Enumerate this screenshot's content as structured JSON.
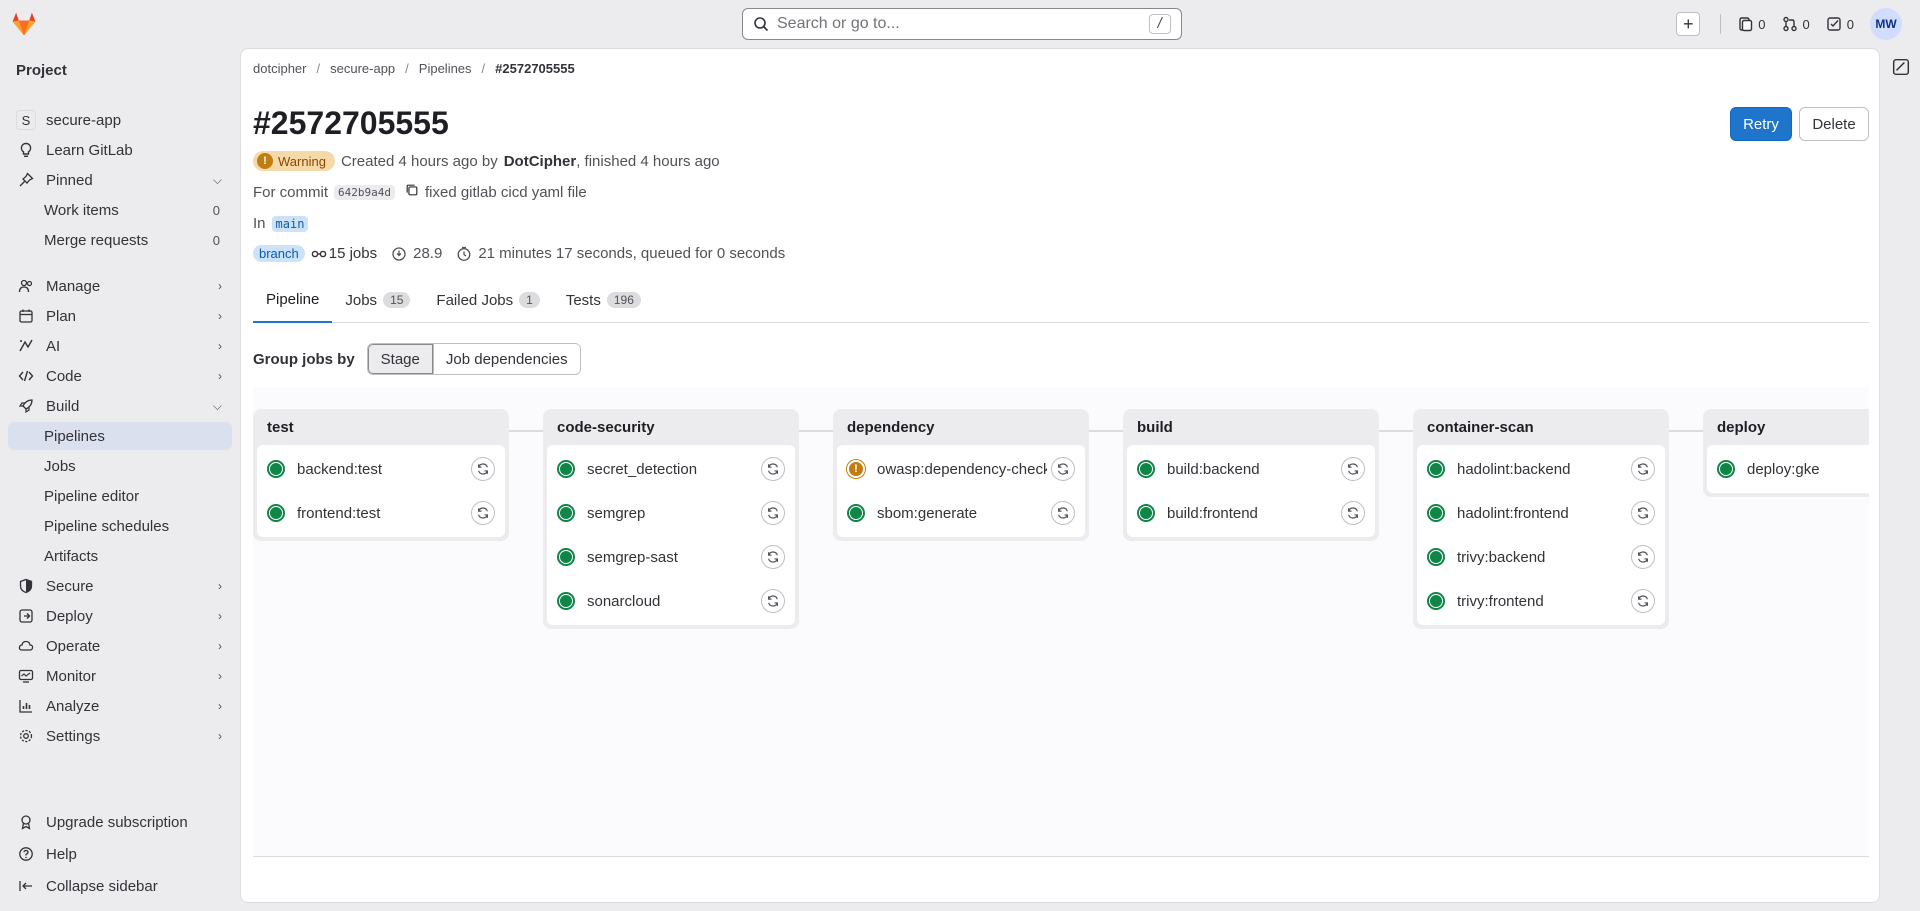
{
  "search": {
    "placeholder": "Search or go to...",
    "shortcut": "/"
  },
  "topbar": {
    "issues_count": "0",
    "merge_requests_count": "0",
    "todos_count": "0",
    "avatar_initials": "MW"
  },
  "sidebar": {
    "heading": "Project",
    "project_initial": "S",
    "items": [
      {
        "label": "secure-app",
        "icon": "project-avatar"
      },
      {
        "label": "Learn GitLab",
        "icon": "bulb-icon"
      },
      {
        "label": "Pinned",
        "icon": "pin-icon"
      },
      {
        "label": "Work items",
        "count": "0"
      },
      {
        "label": "Merge requests",
        "count": "0"
      },
      {
        "label": "Manage",
        "icon": "users-icon"
      },
      {
        "label": "Plan",
        "icon": "planning-icon"
      },
      {
        "label": "AI",
        "icon": "tanuki-ai-icon"
      },
      {
        "label": "Code",
        "icon": "code-icon"
      },
      {
        "label": "Build",
        "icon": "rocket-icon"
      },
      {
        "label": "Pipelines"
      },
      {
        "label": "Jobs"
      },
      {
        "label": "Pipeline editor"
      },
      {
        "label": "Pipeline schedules"
      },
      {
        "label": "Artifacts"
      },
      {
        "label": "Secure",
        "icon": "shield-icon"
      },
      {
        "label": "Deploy",
        "icon": "deployments-icon"
      },
      {
        "label": "Operate",
        "icon": "cloud-gear-icon"
      },
      {
        "label": "Monitor",
        "icon": "monitor-icon"
      },
      {
        "label": "Analyze",
        "icon": "chart-icon"
      },
      {
        "label": "Settings",
        "icon": "settings-icon"
      }
    ],
    "footer": [
      {
        "label": "Upgrade subscription",
        "icon": "license-icon"
      },
      {
        "label": "Help",
        "icon": "question-icon"
      },
      {
        "label": "Collapse sidebar",
        "icon": "collapse-icon"
      }
    ]
  },
  "breadcrumb": [
    "dotcipher",
    "secure-app",
    "Pipelines",
    "#2572705555"
  ],
  "pipeline": {
    "title": "#2572705555",
    "status": "Warning",
    "created_text": "Created 4 hours ago by",
    "author": "DotCipher",
    "finished_text": ", finished 4 hours ago",
    "commit_prefix": "For commit",
    "commit_sha": "642b9a4d",
    "commit_message": "fixed gitlab cicd yaml file",
    "in_prefix": "In",
    "ref": "main",
    "ref_type": "branch",
    "jobs_count": "15 jobs",
    "compute": "28.9",
    "duration": "21 minutes 17 seconds, queued for 0 seconds",
    "retry_label": "Retry",
    "delete_label": "Delete"
  },
  "tabs": [
    {
      "label": "Pipeline",
      "count": null
    },
    {
      "label": "Jobs",
      "count": "15"
    },
    {
      "label": "Failed Jobs",
      "count": "1"
    },
    {
      "label": "Tests",
      "count": "196"
    }
  ],
  "group_by": {
    "label": "Group jobs by",
    "options": [
      "Stage",
      "Job dependencies"
    ],
    "selected": "Stage"
  },
  "stages": [
    {
      "name": "test",
      "jobs": [
        {
          "name": "backend:test",
          "status": "success"
        },
        {
          "name": "frontend:test",
          "status": "success"
        }
      ]
    },
    {
      "name": "code-security",
      "jobs": [
        {
          "name": "secret_detection",
          "status": "success"
        },
        {
          "name": "semgrep",
          "status": "success"
        },
        {
          "name": "semgrep-sast",
          "status": "success"
        },
        {
          "name": "sonarcloud",
          "status": "success"
        }
      ]
    },
    {
      "name": "dependency",
      "jobs": [
        {
          "name": "owasp:dependency-check",
          "status": "warning"
        },
        {
          "name": "sbom:generate",
          "status": "success"
        }
      ]
    },
    {
      "name": "build",
      "jobs": [
        {
          "name": "build:backend",
          "status": "success"
        },
        {
          "name": "build:frontend",
          "status": "success"
        }
      ]
    },
    {
      "name": "container-scan",
      "jobs": [
        {
          "name": "hadolint:backend",
          "status": "success"
        },
        {
          "name": "hadolint:frontend",
          "status": "success"
        },
        {
          "name": "trivy:backend",
          "status": "success"
        },
        {
          "name": "trivy:frontend",
          "status": "success"
        }
      ]
    },
    {
      "name": "deploy",
      "jobs": [
        {
          "name": "deploy:gke",
          "status": "success"
        }
      ]
    }
  ],
  "colors": {
    "primary": "#1f75cb",
    "success": "#108548",
    "warning": "#c17d10"
  }
}
